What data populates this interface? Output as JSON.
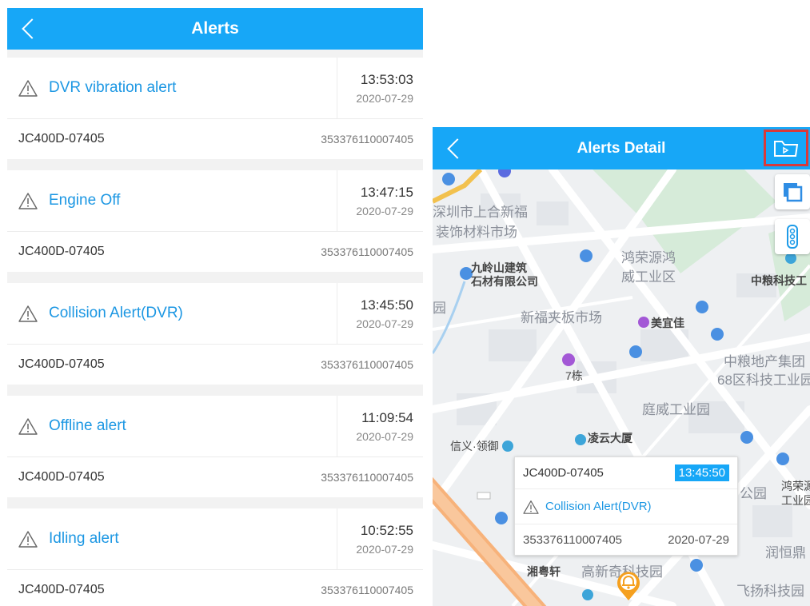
{
  "list_screen": {
    "title": "Alerts",
    "alerts": [
      {
        "type": "DVR  vibration alert",
        "time": "13:53:03",
        "date": "2020-07-29",
        "device": "JC400D-07405",
        "imei": "353376110007405"
      },
      {
        "type": "Engine Off",
        "time": "13:47:15",
        "date": "2020-07-29",
        "device": "JC400D-07405",
        "imei": "353376110007405"
      },
      {
        "type": "Collision Alert(DVR)",
        "time": "13:45:50",
        "date": "2020-07-29",
        "device": "JC400D-07405",
        "imei": "353376110007405"
      },
      {
        "type": "Offline alert",
        "time": "11:09:54",
        "date": "2020-07-29",
        "device": "JC400D-07405",
        "imei": "353376110007405"
      },
      {
        "type": "Idling alert",
        "time": "10:52:55",
        "date": "2020-07-29",
        "device": "JC400D-07405",
        "imei": "353376110007405"
      }
    ]
  },
  "detail_screen": {
    "title": "Alerts Detail",
    "popup": {
      "device": "JC400D-07405",
      "time": "13:45:50",
      "type": "Collision Alert(DVR)",
      "imei": "353376110007405",
      "date": "2020-07-29"
    },
    "map_labels": {
      "l1": "深圳市上合新福",
      "l2": "装饰材料市场",
      "l3": "九岭山建筑",
      "l4": "石材有限公司",
      "l5": "鸿荣源鸿",
      "l6": "威工业区",
      "l7": "中粮科技工",
      "l8": "新福夹板市场",
      "l9": "美宜佳",
      "l10": "7栋",
      "l11": "中粮地产集团",
      "l12": "68区科技工业园",
      "l13": "庭威工业园",
      "l14": "凌云大厦",
      "l15": "信义·领御",
      "l16": "公园",
      "l17": "鸿荣源",
      "l18": "工业园",
      "l19": "润恒鼎",
      "l20": "湘粤轩",
      "l21": "高新奇科技园",
      "l22": "飞扬科技园",
      "l23": "园"
    }
  },
  "colors": {
    "header": "#17a7f7",
    "alert_text": "#1c97e3",
    "highlight_border": "#d93a3a",
    "marker": "#f5a01f"
  },
  "icons": [
    "back-icon",
    "warning-icon",
    "folder-play-icon",
    "layers-icon",
    "traffic-light-icon",
    "alarm-bell-marker-icon"
  ]
}
